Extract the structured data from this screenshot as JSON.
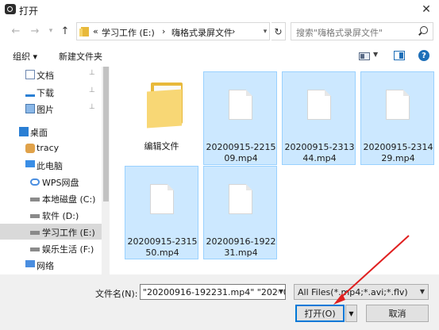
{
  "window": {
    "title": "打开",
    "close_glyph": "✕"
  },
  "nav_buttons": {
    "back": "←",
    "forward": "→",
    "up": "↑"
  },
  "address": {
    "breadcrumbs": [
      "«",
      "学习工作 (E:)",
      "›",
      "嗨格式录屏文件",
      "›"
    ]
  },
  "search": {
    "placeholder": "搜索\"嗨格式录屏文件\""
  },
  "toolbar": {
    "organize_label": "组织 ▾",
    "new_folder_label": "新建文件夹"
  },
  "sidebar": {
    "items": [
      {
        "label": "文档",
        "pinned": true,
        "icon": "documents-icon"
      },
      {
        "label": "下载",
        "pinned": true,
        "icon": "download-icon"
      },
      {
        "label": "图片",
        "pinned": true,
        "icon": "pictures-icon"
      },
      {
        "label": "桌面",
        "pinned": false,
        "icon": "desktop-icon"
      },
      {
        "label": "tracy",
        "pinned": false,
        "icon": "user-icon"
      },
      {
        "label": "此电脑",
        "pinned": false,
        "icon": "computer-icon"
      },
      {
        "label": "WPS网盘",
        "pinned": false,
        "icon": "cloud-icon"
      },
      {
        "label": "本地磁盘 (C:)",
        "pinned": false,
        "icon": "drive-icon"
      },
      {
        "label": "软件 (D:)",
        "pinned": false,
        "icon": "drive-icon"
      },
      {
        "label": "学习工作 (E:)",
        "pinned": false,
        "icon": "drive-icon",
        "selected": true
      },
      {
        "label": "娱乐生活 (F:)",
        "pinned": false,
        "icon": "drive-icon"
      },
      {
        "label": "网络",
        "pinned": false,
        "icon": "network-icon"
      }
    ],
    "pin_glyph": "📌"
  },
  "files": [
    {
      "name": "编辑文件",
      "type": "folder",
      "selected": false
    },
    {
      "name": "20200915-221509.mp4",
      "type": "file",
      "selected": true
    },
    {
      "name": "20200915-231344.mp4",
      "type": "file",
      "selected": true
    },
    {
      "name": "20200915-231429.mp4",
      "type": "file",
      "selected": true
    },
    {
      "name": "20200915-231550.mp4",
      "type": "file",
      "selected": true
    },
    {
      "name": "20200916-192231.mp4",
      "type": "file",
      "selected": true
    }
  ],
  "footer": {
    "filename_label": "文件名(N):",
    "filename_value": "\"20200916-192231.mp4\" \"20200",
    "filetype_value": "All Files(*.mp4;*.avi;*.flv)",
    "open_label": "打开(O)",
    "cancel_label": "取消"
  },
  "colors": {
    "selection_bg": "#cce8ff",
    "selection_border": "#99d1ff",
    "annotation_arrow": "#e02020"
  }
}
